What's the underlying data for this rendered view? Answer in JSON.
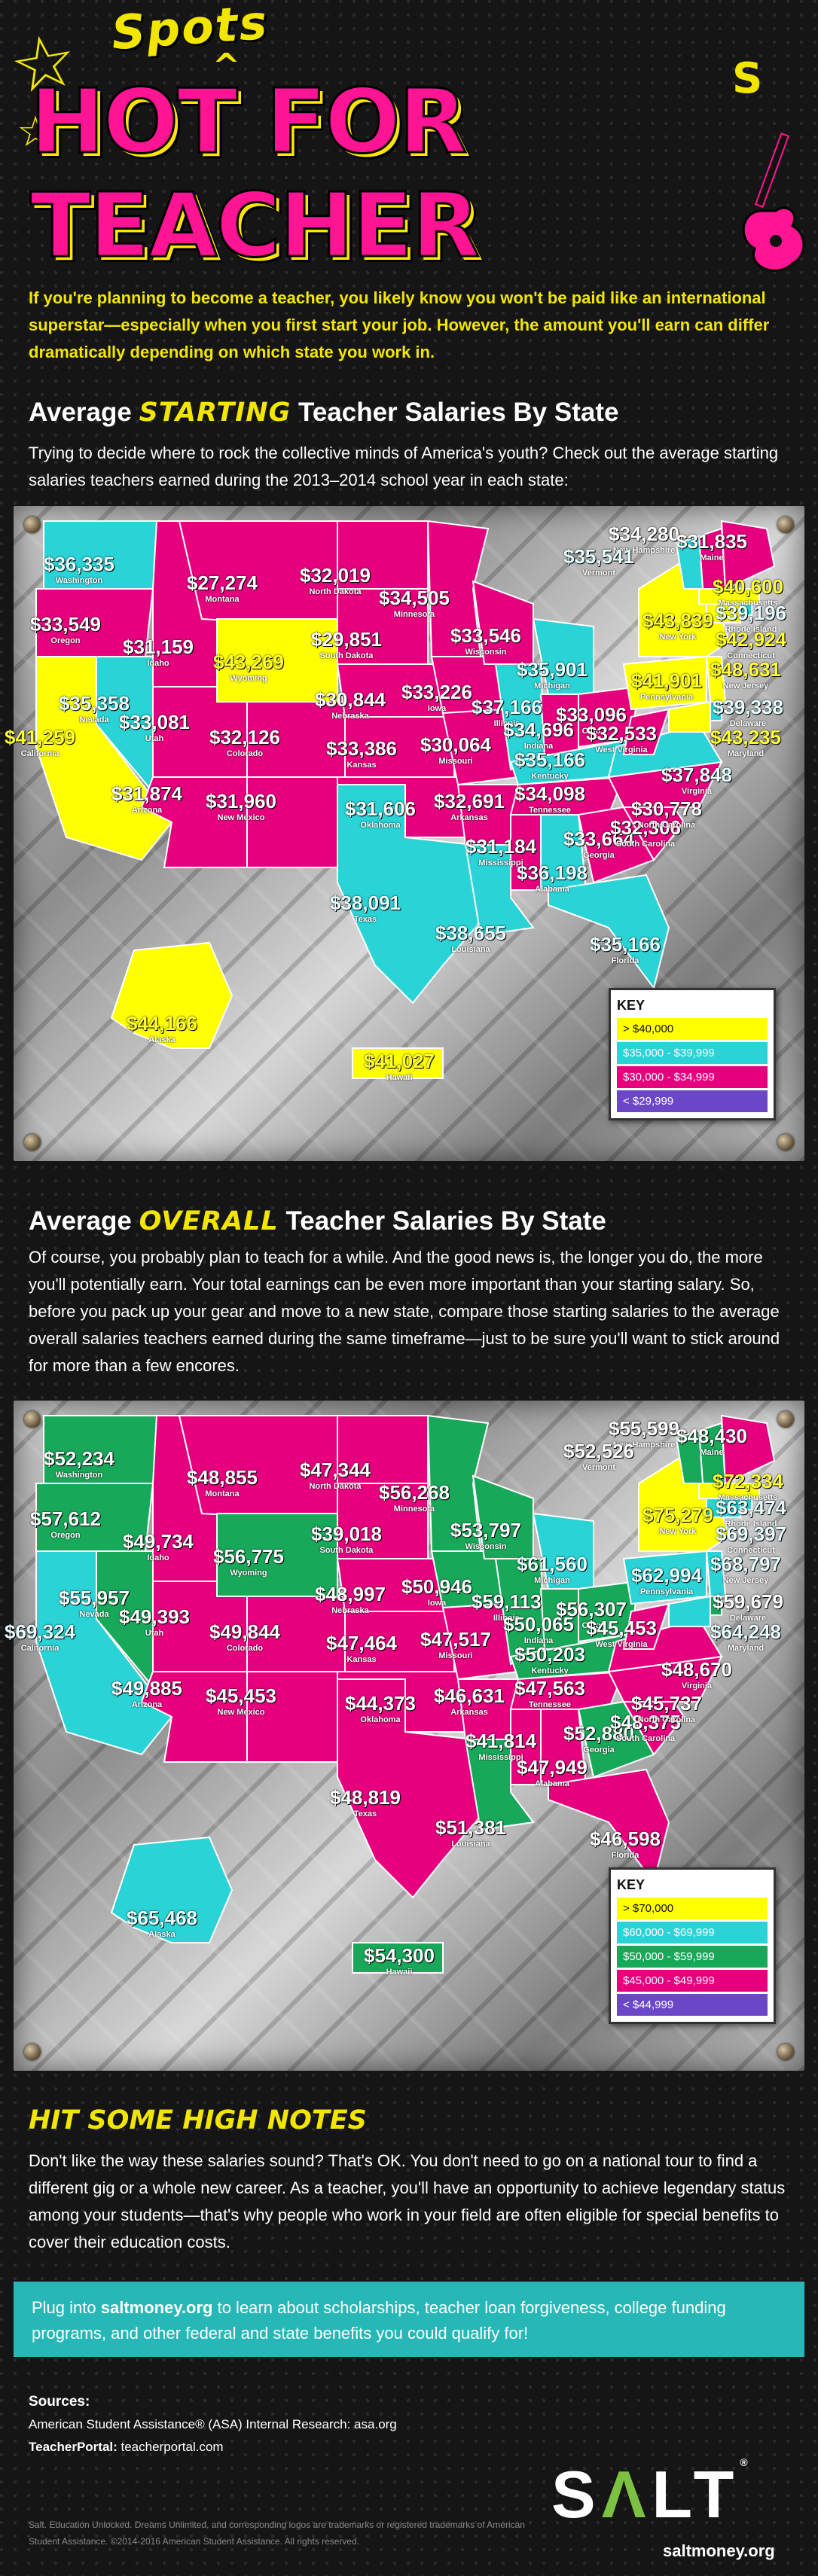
{
  "header": {
    "title_small": "Spots",
    "title_main": "HOT FOR TEACHER",
    "title_s": "S",
    "intro": "If you're planning to become a teacher, you likely know you won't be paid like an international superstar—especially when you first start your job. However, the amount you'll earn can differ dramatically depending on which state you work in."
  },
  "starting": {
    "title_a": "Average ",
    "title_b": "STARTING",
    "title_c": " Teacher Salaries By State",
    "text": "Trying to decide where to rock the collective minds of America's youth? Check out the average starting salaries teachers earned during the 2013–2014 school year in each state:",
    "key": {
      "title": "KEY",
      "items": [
        {
          "label": "> $40,000",
          "color": "#ffff00",
          "text": "#111"
        },
        {
          "label": "$35,000 - $39,999",
          "color": "#29d3d6",
          "text": "#fff"
        },
        {
          "label": "$30,000 - $34,999",
          "color": "#e6007e",
          "text": "#fff"
        },
        {
          "label": "< $29,999",
          "color": "#6b47c8",
          "text": "#fff"
        }
      ]
    },
    "states": [
      {
        "v": "$36,335",
        "n": "Washington",
        "c": "c"
      },
      {
        "v": "$33,549",
        "n": "Oregon",
        "c": "p"
      },
      {
        "v": "$41,259",
        "n": "California",
        "c": "y"
      },
      {
        "v": "$35,358",
        "n": "Nevada",
        "c": "c"
      },
      {
        "v": "$31,159",
        "n": "Idaho",
        "c": "p"
      },
      {
        "v": "$27,274",
        "n": "Montana",
        "c": "p"
      },
      {
        "v": "$43,269",
        "n": "Wyoming",
        "c": "y"
      },
      {
        "v": "$33,081",
        "n": "Utah",
        "c": "p"
      },
      {
        "v": "$31,874",
        "n": "Arizona",
        "c": "p"
      },
      {
        "v": "$32,126",
        "n": "Colorado",
        "c": "p"
      },
      {
        "v": "$31,960",
        "n": "New Mexico",
        "c": "p"
      },
      {
        "v": "$32,019",
        "n": "North Dakota",
        "c": "p"
      },
      {
        "v": "$29,851",
        "n": "South Dakota",
        "c": "p"
      },
      {
        "v": "$30,844",
        "n": "Nebraska",
        "c": "p"
      },
      {
        "v": "$33,386",
        "n": "Kansas",
        "c": "p"
      },
      {
        "v": "$31,606",
        "n": "Oklahoma",
        "c": "p"
      },
      {
        "v": "$38,091",
        "n": "Texas",
        "c": "c"
      },
      {
        "v": "$34,505",
        "n": "Minnesota",
        "c": "p"
      },
      {
        "v": "$33,226",
        "n": "Iowa",
        "c": "p"
      },
      {
        "v": "$30,064",
        "n": "Missouri",
        "c": "p"
      },
      {
        "v": "$32,691",
        "n": "Arkansas",
        "c": "p"
      },
      {
        "v": "$38,655",
        "n": "Louisiana",
        "c": "c"
      },
      {
        "v": "$33,546",
        "n": "Wisconsin",
        "c": "p"
      },
      {
        "v": "$37,166",
        "n": "Illinois",
        "c": "c"
      },
      {
        "v": "$35,901",
        "n": "Michigan",
        "c": "c"
      },
      {
        "v": "$34,696",
        "n": "Indiana",
        "c": "p"
      },
      {
        "v": "$33,096",
        "n": "Ohio",
        "c": "p"
      },
      {
        "v": "$35,166",
        "n": "Kentucky",
        "c": "c"
      },
      {
        "v": "$34,098",
        "n": "Tennessee",
        "c": "p"
      },
      {
        "v": "$31,184",
        "n": "Mississippi",
        "c": "p"
      },
      {
        "v": "$36,198",
        "n": "Alabama",
        "c": "c"
      },
      {
        "v": "$33,664",
        "n": "Georgia",
        "c": "p"
      },
      {
        "v": "$35,166",
        "n": "Florida",
        "c": "c"
      },
      {
        "v": "$32,306",
        "n": "South Carolina",
        "c": "p"
      },
      {
        "v": "$30,778",
        "n": "North Carolina",
        "c": "p"
      },
      {
        "v": "$37,848",
        "n": "Virginia",
        "c": "c"
      },
      {
        "v": "$32,533",
        "n": "West Virginia",
        "c": "p"
      },
      {
        "v": "$41,901",
        "n": "Pennsylvania",
        "c": "y"
      },
      {
        "v": "$43,839",
        "n": "New York",
        "c": "y"
      },
      {
        "v": "$34,280",
        "n": "New Hampshire",
        "c": "p"
      },
      {
        "v": "$35,541",
        "n": "Vermont",
        "c": "c"
      },
      {
        "v": "$31,835",
        "n": "Maine",
        "c": "p"
      },
      {
        "v": "$40,600",
        "n": "Massachusetts",
        "c": "y"
      },
      {
        "v": "$39,196",
        "n": "Rhode Island",
        "c": "c"
      },
      {
        "v": "$42,924",
        "n": "Connecticut",
        "c": "y"
      },
      {
        "v": "$48,631",
        "n": "New Jersey",
        "c": "y"
      },
      {
        "v": "$39,338",
        "n": "Delaware",
        "c": "c"
      },
      {
        "v": "$43,235",
        "n": "Maryland",
        "c": "y"
      },
      {
        "v": "$44,166",
        "n": "Alaska",
        "c": "y"
      },
      {
        "v": "$41,027",
        "n": "Hawaii",
        "c": "y"
      }
    ]
  },
  "overall": {
    "title_a": "Average ",
    "title_b": "OVERALL",
    "title_c": " Teacher Salaries By State",
    "text": "Of course, you probably plan to teach for a while. And the good news is, the longer you do, the more you'll potentially earn. Your total earnings can be even more important than your starting salary. So, before you pack up your gear and move to a new state, compare those starting salaries to the average overall salaries teachers earned during the same timeframe—just to be sure you'll want to stick around for more than a few encores.",
    "key": {
      "title": "KEY",
      "items": [
        {
          "label": "> $70,000",
          "color": "#ffff00",
          "text": "#111"
        },
        {
          "label": "$60,000 - $69,999",
          "color": "#29d3d6",
          "text": "#fff"
        },
        {
          "label": "$50,000 - $59,999",
          "color": "#18a85a",
          "text": "#fff"
        },
        {
          "label": "$45,000 - $49,999",
          "color": "#e6007e",
          "text": "#fff"
        },
        {
          "label": "< $44,999",
          "color": "#6b47c8",
          "text": "#fff"
        }
      ]
    },
    "states": [
      {
        "v": "$52,234",
        "n": "Washington",
        "c": "g"
      },
      {
        "v": "$57,612",
        "n": "Oregon",
        "c": "g"
      },
      {
        "v": "$69,324",
        "n": "California",
        "c": "c"
      },
      {
        "v": "$55,957",
        "n": "Nevada",
        "c": "g"
      },
      {
        "v": "$49,734",
        "n": "Idaho",
        "c": "p"
      },
      {
        "v": "$48,855",
        "n": "Montana",
        "c": "p"
      },
      {
        "v": "$56,775",
        "n": "Wyoming",
        "c": "g"
      },
      {
        "v": "$49,393",
        "n": "Utah",
        "c": "p"
      },
      {
        "v": "$49,885",
        "n": "Arizona",
        "c": "p"
      },
      {
        "v": "$49,844",
        "n": "Colorado",
        "c": "p"
      },
      {
        "v": "$45,453",
        "n": "New Mexico",
        "c": "p"
      },
      {
        "v": "$47,344",
        "n": "North Dakota",
        "c": "p"
      },
      {
        "v": "$39,018",
        "n": "South Dakota",
        "c": "p"
      },
      {
        "v": "$48,997",
        "n": "Nebraska",
        "c": "p"
      },
      {
        "v": "$47,464",
        "n": "Kansas",
        "c": "p"
      },
      {
        "v": "$44,373",
        "n": "Oklahoma",
        "c": "p"
      },
      {
        "v": "$48,819",
        "n": "Texas",
        "c": "p"
      },
      {
        "v": "$56,268",
        "n": "Minnesota",
        "c": "g"
      },
      {
        "v": "$50,946",
        "n": "Iowa",
        "c": "g"
      },
      {
        "v": "$47,517",
        "n": "Missouri",
        "c": "p"
      },
      {
        "v": "$46,631",
        "n": "Arkansas",
        "c": "p"
      },
      {
        "v": "$51,381",
        "n": "Louisiana",
        "c": "g"
      },
      {
        "v": "$53,797",
        "n": "Wisconsin",
        "c": "g"
      },
      {
        "v": "$59,113",
        "n": "Illinois",
        "c": "g"
      },
      {
        "v": "$61,560",
        "n": "Michigan",
        "c": "c"
      },
      {
        "v": "$50,065",
        "n": "Indiana",
        "c": "g"
      },
      {
        "v": "$56,307",
        "n": "Ohio",
        "c": "g"
      },
      {
        "v": "$50,203",
        "n": "Kentucky",
        "c": "g"
      },
      {
        "v": "$47,563",
        "n": "Tennessee",
        "c": "p"
      },
      {
        "v": "$41,814",
        "n": "Mississippi",
        "c": "p"
      },
      {
        "v": "$47,949",
        "n": "Alabama",
        "c": "p"
      },
      {
        "v": "$52,880",
        "n": "Georgia",
        "c": "g"
      },
      {
        "v": "$46,598",
        "n": "Florida",
        "c": "p"
      },
      {
        "v": "$48,375",
        "n": "South Carolina",
        "c": "p"
      },
      {
        "v": "$45,737",
        "n": "North Carolina",
        "c": "p"
      },
      {
        "v": "$48,670",
        "n": "Virginia",
        "c": "p"
      },
      {
        "v": "$45,453",
        "n": "West Virginia",
        "c": "p"
      },
      {
        "v": "$62,994",
        "n": "Pennsylvania",
        "c": "c"
      },
      {
        "v": "$75,279",
        "n": "New York",
        "c": "y"
      },
      {
        "v": "$55,599",
        "n": "New Hampshire",
        "c": "g"
      },
      {
        "v": "$52,526",
        "n": "Vermont",
        "c": "g"
      },
      {
        "v": "$48,430",
        "n": "Maine",
        "c": "p"
      },
      {
        "v": "$72,334",
        "n": "Massachusetts",
        "c": "y"
      },
      {
        "v": "$63,474",
        "n": "Rhode Island",
        "c": "c"
      },
      {
        "v": "$69,397",
        "n": "Connecticut",
        "c": "c"
      },
      {
        "v": "$68,797",
        "n": "New Jersey",
        "c": "c"
      },
      {
        "v": "$59,679",
        "n": "Delaware",
        "c": "g"
      },
      {
        "v": "$64,248",
        "n": "Maryland",
        "c": "c"
      },
      {
        "v": "$65,468",
        "n": "Alaska",
        "c": "c"
      },
      {
        "v": "$54,300",
        "n": "Hawaii",
        "c": "g"
      }
    ]
  },
  "notes": {
    "title": "HIT SOME HIGH NOTES",
    "text": "Don't like the way these salaries sound? That's OK. You don't need to go on a national tour to find a different gig or a whole new career. As a teacher, you'll have an opportunity to achieve legendary status among your students—that's why people who work in your field are often eligible for special benefits to cover their education costs."
  },
  "callout": {
    "pre": "Plug into ",
    "link": "saltmoney.org",
    "post": " to learn about scholarships, teacher loan forgiveness, college funding programs, and other federal and state benefits you could qualify for!"
  },
  "sources": {
    "title": "Sources:",
    "line1": "American Student Assistance® (ASA) Internal Research: asa.org",
    "line2_bold": "TeacherPortal:",
    "line2": " teacherportal.com"
  },
  "disclaimer": "Salt. Education Unlocked. Dreams Unlimited, and corresponding logos are trademarks or registered trademarks of American Student Assistance. ©2014-2016 American Student Assistance. All rights reserved.",
  "logo": {
    "text_a": "S",
    "text_b": "Λ",
    "text_c": "LT",
    "tm": "®",
    "site": "saltmoney.org"
  },
  "colors": {
    "yellow": "#ffff00",
    "cyan": "#29d3d6",
    "magenta": "#e6007e",
    "purple": "#6b47c8",
    "green": "#18a85a",
    "teal": "#27b7b7"
  }
}
